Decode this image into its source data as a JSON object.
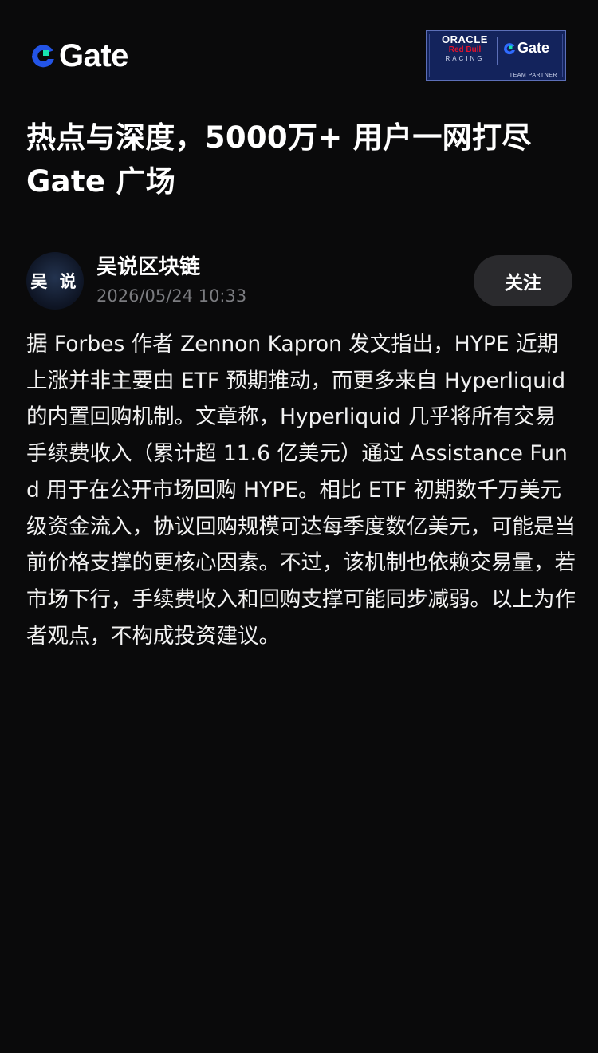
{
  "header": {
    "logo_text": "Gate",
    "logo_colors": {
      "arc": "#2354e6",
      "square": "#17e3b0"
    },
    "partner_badge": {
      "oracle": "ORACLE",
      "redbull": "Red Bull",
      "racing": "RACING",
      "gate": "Gate",
      "team_partner": "TEAM PARTNER",
      "background": "#13235c"
    }
  },
  "headline": "热点与深度，5000万+ 用户一网打尽 Gate 广场",
  "author": {
    "avatar_text": "吴 说",
    "name": "吴说区块链",
    "time": "2026/05/24 10:33"
  },
  "follow_button": {
    "label": "关注"
  },
  "body": "据 Forbes 作者 Zennon Kapron 发文指出，HYPE 近期上涨并非主要由 ETF 预期推动，而更多来自 Hyperliquid 的内置回购机制。文章称，Hyperliquid 几乎将所有交易手续费收入（累计超 11.6 亿美元）通过 Assistance Fund 用于在公开市场回购 HYPE。相比 ETF 初期数千万美元级资金流入，协议回购规模可达每季度数亿美元，可能是当前价格支撑的更核心因素。不过，该机制也依赖交易量，若市场下行，手续费收入和回购支撑可能同步减弱。以上为作者观点，不构成投资建议。",
  "colors": {
    "page_background": "#0a0a0b",
    "follow_button_background": "#2a2a2d",
    "muted_text": "#7b7c80"
  }
}
